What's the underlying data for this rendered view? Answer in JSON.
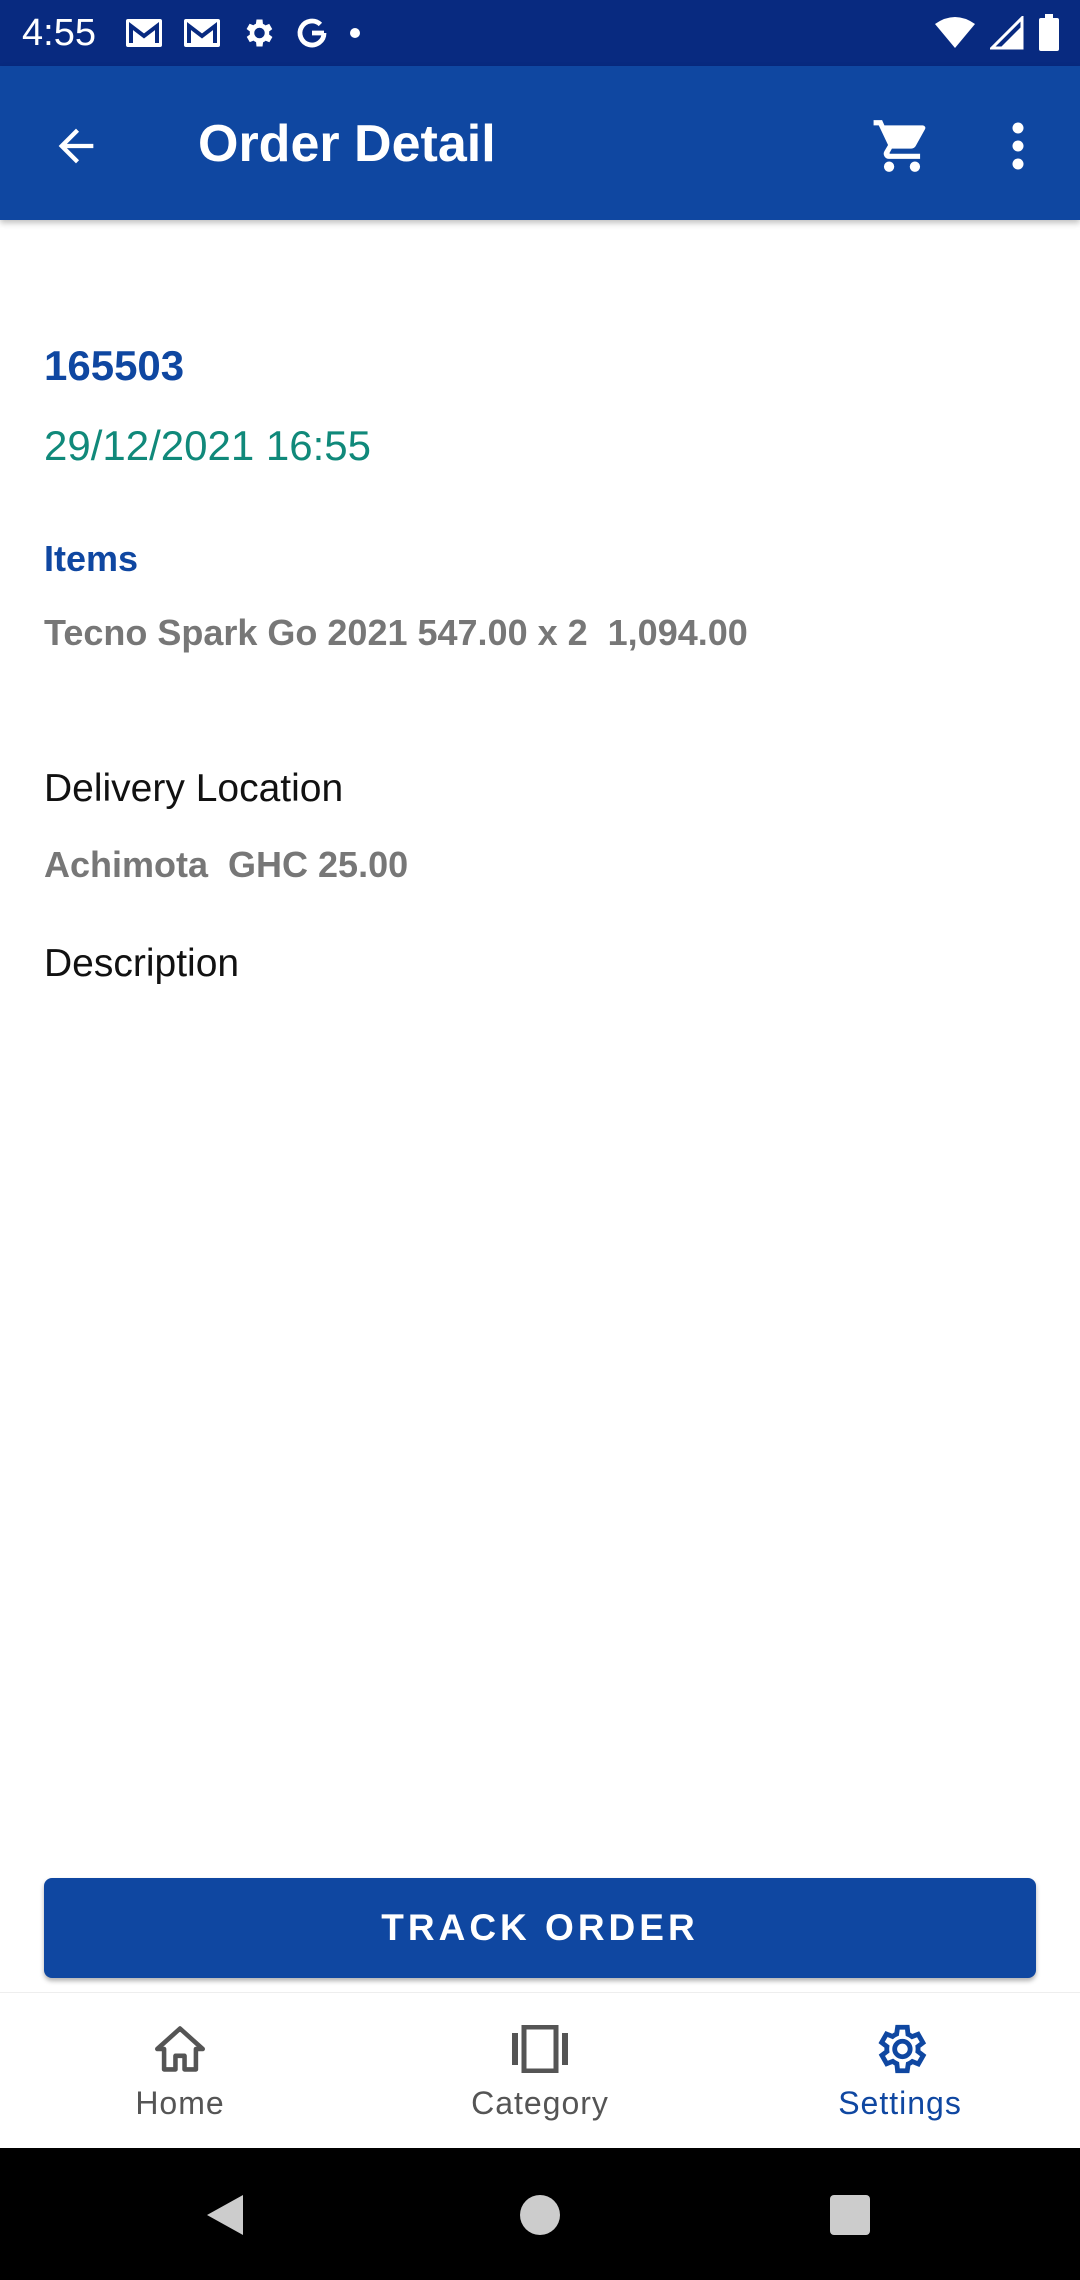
{
  "status_bar": {
    "time": "4:55",
    "left_icons": [
      "gmail-icon",
      "gmail-icon",
      "settings-gear-icon",
      "google-icon",
      "notification-dot-icon"
    ],
    "right_icons": [
      "wifi-icon",
      "cellular-signal-icon",
      "battery-icon"
    ]
  },
  "app_bar": {
    "title": "Order Detail",
    "back_icon": "arrow-back-icon",
    "cart_icon": "shopping-cart-icon",
    "more_icon": "more-vertical-icon",
    "color": "#0f47a1"
  },
  "order": {
    "id": "165503",
    "date": "29/12/2021 16:55",
    "items_label": "Items",
    "items": [
      {
        "text": "Tecno Spark Go 2021 547.00 x 2  1,094.00"
      }
    ],
    "delivery_label": "Delivery Location",
    "delivery_value": "Achimota  GHC 25.00",
    "description_label": "Description"
  },
  "actions": {
    "track_order_label": "TRACK ORDER"
  },
  "bottom_nav": {
    "items": [
      {
        "label": "Home",
        "icon": "home-icon",
        "active": false
      },
      {
        "label": "Category",
        "icon": "category-carousel-icon",
        "active": false
      },
      {
        "label": "Settings",
        "icon": "settings-gear-icon",
        "active": true
      }
    ]
  },
  "system_nav": {
    "icons": [
      "system-back-icon",
      "system-home-icon",
      "system-recents-icon"
    ]
  },
  "colors": {
    "primary": "#0f47a1",
    "status_bar": "#082a80",
    "date_green": "#10897a",
    "muted_text": "#777777"
  }
}
